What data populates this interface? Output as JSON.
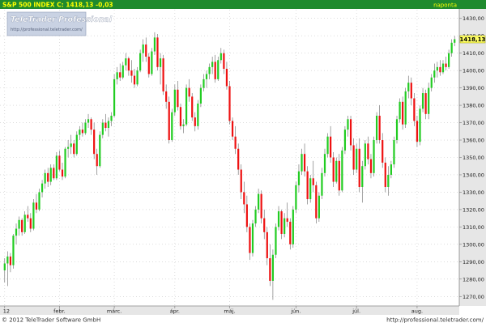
{
  "header": {
    "series_label": "S&P 500 INDEX C: 1418,13 -0,03",
    "period_label": "naponta"
  },
  "watermark": {
    "title": "TeleTrader Professional",
    "url": "http://professional.teletrader.com/"
  },
  "footer": {
    "copyright": "© 2012 TeleTrader Software GmbH",
    "url": "http://professional.teletrader.com/"
  },
  "last_price_label": "1418,13",
  "colors": {
    "header_bg": "#1f8a2e",
    "header_text": "#ffff00",
    "up": "#22cc22",
    "down": "#ee1111",
    "wick": "#666666",
    "grid": "#c8c8c8",
    "axis_panel": "#e6e6e6",
    "price_box": "#ffff66"
  },
  "chart_data": {
    "type": "candlestick",
    "title": "S&P 500 INDEX",
    "ylim": [
      1265,
      1435
    ],
    "y_ticks": [
      1270,
      1280,
      1290,
      1300,
      1310,
      1320,
      1330,
      1340,
      1350,
      1360,
      1370,
      1380,
      1390,
      1400,
      1410,
      1420,
      1430
    ],
    "y_tick_labels": [
      "1270,00",
      "1280,00",
      "1290,00",
      "1300,00",
      "1310,00",
      "1320,00",
      "1330,00",
      "1340,00",
      "1350,00",
      "1360,00",
      "1370,00",
      "1380,00",
      "1390,00",
      "1400,00",
      "1410,00",
      "1420,00",
      "1430,00"
    ],
    "x_ticks": [
      {
        "label": "12",
        "index": 0
      },
      {
        "label": "febr.",
        "index": 19
      },
      {
        "label": "márc.",
        "index": 38
      },
      {
        "label": "ápr.",
        "index": 59
      },
      {
        "label": "máj.",
        "index": 78
      },
      {
        "label": "jún.",
        "index": 101
      },
      {
        "label": "júl.",
        "index": 122
      },
      {
        "label": "aug.",
        "index": 143
      }
    ],
    "grid": true,
    "ohlc": [
      {
        "o": 1285,
        "h": 1292,
        "l": 1278,
        "c": 1289
      },
      {
        "o": 1289,
        "h": 1296,
        "l": 1276,
        "c": 1293
      },
      {
        "o": 1293,
        "h": 1295,
        "l": 1284,
        "c": 1288
      },
      {
        "o": 1288,
        "h": 1306,
        "l": 1286,
        "c": 1305
      },
      {
        "o": 1305,
        "h": 1312,
        "l": 1300,
        "c": 1309
      },
      {
        "o": 1309,
        "h": 1316,
        "l": 1305,
        "c": 1314
      },
      {
        "o": 1314,
        "h": 1315,
        "l": 1305,
        "c": 1307
      },
      {
        "o": 1307,
        "h": 1319,
        "l": 1306,
        "c": 1317
      },
      {
        "o": 1317,
        "h": 1322,
        "l": 1313,
        "c": 1315
      },
      {
        "o": 1315,
        "h": 1318,
        "l": 1307,
        "c": 1309
      },
      {
        "o": 1309,
        "h": 1326,
        "l": 1308,
        "c": 1324
      },
      {
        "o": 1324,
        "h": 1329,
        "l": 1318,
        "c": 1320
      },
      {
        "o": 1320,
        "h": 1332,
        "l": 1319,
        "c": 1330
      },
      {
        "o": 1330,
        "h": 1337,
        "l": 1327,
        "c": 1335
      },
      {
        "o": 1335,
        "h": 1343,
        "l": 1332,
        "c": 1341
      },
      {
        "o": 1341,
        "h": 1344,
        "l": 1333,
        "c": 1336
      },
      {
        "o": 1336,
        "h": 1346,
        "l": 1334,
        "c": 1344
      },
      {
        "o": 1344,
        "h": 1346,
        "l": 1337,
        "c": 1338
      },
      {
        "o": 1338,
        "h": 1353,
        "l": 1337,
        "c": 1351
      },
      {
        "o": 1351,
        "h": 1354,
        "l": 1342,
        "c": 1343
      },
      {
        "o": 1343,
        "h": 1347,
        "l": 1337,
        "c": 1339
      },
      {
        "o": 1339,
        "h": 1356,
        "l": 1338,
        "c": 1355
      },
      {
        "o": 1355,
        "h": 1360,
        "l": 1350,
        "c": 1356
      },
      {
        "o": 1356,
        "h": 1363,
        "l": 1352,
        "c": 1358
      },
      {
        "o": 1358,
        "h": 1360,
        "l": 1350,
        "c": 1352
      },
      {
        "o": 1352,
        "h": 1365,
        "l": 1351,
        "c": 1363
      },
      {
        "o": 1363,
        "h": 1368,
        "l": 1360,
        "c": 1366
      },
      {
        "o": 1366,
        "h": 1370,
        "l": 1362,
        "c": 1364
      },
      {
        "o": 1364,
        "h": 1372,
        "l": 1363,
        "c": 1370
      },
      {
        "o": 1370,
        "h": 1375,
        "l": 1367,
        "c": 1372
      },
      {
        "o": 1372,
        "h": 1373,
        "l": 1363,
        "c": 1366
      },
      {
        "o": 1366,
        "h": 1370,
        "l": 1349,
        "c": 1352
      },
      {
        "o": 1352,
        "h": 1355,
        "l": 1340,
        "c": 1345
      },
      {
        "o": 1345,
        "h": 1365,
        "l": 1344,
        "c": 1363
      },
      {
        "o": 1363,
        "h": 1372,
        "l": 1361,
        "c": 1370
      },
      {
        "o": 1370,
        "h": 1375,
        "l": 1365,
        "c": 1367
      },
      {
        "o": 1367,
        "h": 1373,
        "l": 1362,
        "c": 1371
      },
      {
        "o": 1371,
        "h": 1376,
        "l": 1368,
        "c": 1374
      },
      {
        "o": 1374,
        "h": 1398,
        "l": 1373,
        "c": 1395
      },
      {
        "o": 1395,
        "h": 1402,
        "l": 1392,
        "c": 1399
      },
      {
        "o": 1399,
        "h": 1404,
        "l": 1394,
        "c": 1396
      },
      {
        "o": 1396,
        "h": 1405,
        "l": 1395,
        "c": 1403
      },
      {
        "o": 1403,
        "h": 1410,
        "l": 1400,
        "c": 1407
      },
      {
        "o": 1407,
        "h": 1408,
        "l": 1397,
        "c": 1400
      },
      {
        "o": 1400,
        "h": 1406,
        "l": 1393,
        "c": 1397
      },
      {
        "o": 1397,
        "h": 1401,
        "l": 1390,
        "c": 1392
      },
      {
        "o": 1392,
        "h": 1402,
        "l": 1391,
        "c": 1400
      },
      {
        "o": 1400,
        "h": 1412,
        "l": 1399,
        "c": 1410
      },
      {
        "o": 1410,
        "h": 1418,
        "l": 1405,
        "c": 1415
      },
      {
        "o": 1415,
        "h": 1419,
        "l": 1405,
        "c": 1408
      },
      {
        "o": 1408,
        "h": 1410,
        "l": 1396,
        "c": 1398
      },
      {
        "o": 1398,
        "h": 1413,
        "l": 1397,
        "c": 1411
      },
      {
        "o": 1411,
        "h": 1422,
        "l": 1409,
        "c": 1419
      },
      {
        "o": 1419,
        "h": 1421,
        "l": 1400,
        "c": 1402
      },
      {
        "o": 1402,
        "h": 1410,
        "l": 1392,
        "c": 1407
      },
      {
        "o": 1407,
        "h": 1409,
        "l": 1386,
        "c": 1388
      },
      {
        "o": 1388,
        "h": 1392,
        "l": 1378,
        "c": 1382
      },
      {
        "o": 1382,
        "h": 1385,
        "l": 1358,
        "c": 1360
      },
      {
        "o": 1360,
        "h": 1378,
        "l": 1359,
        "c": 1376
      },
      {
        "o": 1376,
        "h": 1392,
        "l": 1374,
        "c": 1389
      },
      {
        "o": 1389,
        "h": 1394,
        "l": 1377,
        "c": 1379
      },
      {
        "o": 1379,
        "h": 1381,
        "l": 1366,
        "c": 1368
      },
      {
        "o": 1368,
        "h": 1372,
        "l": 1364,
        "c": 1369
      },
      {
        "o": 1369,
        "h": 1392,
        "l": 1368,
        "c": 1390
      },
      {
        "o": 1390,
        "h": 1395,
        "l": 1382,
        "c": 1385
      },
      {
        "o": 1385,
        "h": 1387,
        "l": 1371,
        "c": 1373
      },
      {
        "o": 1373,
        "h": 1376,
        "l": 1365,
        "c": 1368
      },
      {
        "o": 1368,
        "h": 1383,
        "l": 1366,
        "c": 1381
      },
      {
        "o": 1381,
        "h": 1392,
        "l": 1379,
        "c": 1390
      },
      {
        "o": 1390,
        "h": 1398,
        "l": 1388,
        "c": 1395
      },
      {
        "o": 1395,
        "h": 1400,
        "l": 1390,
        "c": 1398
      },
      {
        "o": 1398,
        "h": 1404,
        "l": 1395,
        "c": 1402
      },
      {
        "o": 1402,
        "h": 1408,
        "l": 1398,
        "c": 1405
      },
      {
        "o": 1405,
        "h": 1409,
        "l": 1393,
        "c": 1395
      },
      {
        "o": 1395,
        "h": 1408,
        "l": 1394,
        "c": 1406
      },
      {
        "o": 1406,
        "h": 1413,
        "l": 1404,
        "c": 1410
      },
      {
        "o": 1410,
        "h": 1412,
        "l": 1398,
        "c": 1401
      },
      {
        "o": 1401,
        "h": 1405,
        "l": 1389,
        "c": 1391
      },
      {
        "o": 1391,
        "h": 1394,
        "l": 1369,
        "c": 1371
      },
      {
        "o": 1371,
        "h": 1373,
        "l": 1360,
        "c": 1362
      },
      {
        "o": 1362,
        "h": 1368,
        "l": 1352,
        "c": 1355
      },
      {
        "o": 1355,
        "h": 1358,
        "l": 1340,
        "c": 1343
      },
      {
        "o": 1343,
        "h": 1346,
        "l": 1326,
        "c": 1330
      },
      {
        "o": 1330,
        "h": 1336,
        "l": 1318,
        "c": 1323
      },
      {
        "o": 1323,
        "h": 1328,
        "l": 1307,
        "c": 1310
      },
      {
        "o": 1310,
        "h": 1312,
        "l": 1291,
        "c": 1295
      },
      {
        "o": 1295,
        "h": 1314,
        "l": 1293,
        "c": 1312
      },
      {
        "o": 1312,
        "h": 1322,
        "l": 1310,
        "c": 1320
      },
      {
        "o": 1320,
        "h": 1332,
        "l": 1318,
        "c": 1329
      },
      {
        "o": 1329,
        "h": 1331,
        "l": 1312,
        "c": 1315
      },
      {
        "o": 1315,
        "h": 1320,
        "l": 1303,
        "c": 1307
      },
      {
        "o": 1307,
        "h": 1310,
        "l": 1288,
        "c": 1292
      },
      {
        "o": 1292,
        "h": 1300,
        "l": 1276,
        "c": 1279
      },
      {
        "o": 1279,
        "h": 1297,
        "l": 1268,
        "c": 1294
      },
      {
        "o": 1294,
        "h": 1312,
        "l": 1292,
        "c": 1310
      },
      {
        "o": 1310,
        "h": 1322,
        "l": 1308,
        "c": 1319
      },
      {
        "o": 1319,
        "h": 1320,
        "l": 1303,
        "c": 1306
      },
      {
        "o": 1306,
        "h": 1318,
        "l": 1304,
        "c": 1315
      },
      {
        "o": 1315,
        "h": 1324,
        "l": 1310,
        "c": 1313
      },
      {
        "o": 1313,
        "h": 1315,
        "l": 1297,
        "c": 1300
      },
      {
        "o": 1300,
        "h": 1322,
        "l": 1298,
        "c": 1320
      },
      {
        "o": 1320,
        "h": 1336,
        "l": 1318,
        "c": 1334
      },
      {
        "o": 1334,
        "h": 1346,
        "l": 1330,
        "c": 1342
      },
      {
        "o": 1342,
        "h": 1355,
        "l": 1340,
        "c": 1352
      },
      {
        "o": 1352,
        "h": 1358,
        "l": 1339,
        "c": 1342
      },
      {
        "o": 1342,
        "h": 1345,
        "l": 1323,
        "c": 1326
      },
      {
        "o": 1326,
        "h": 1340,
        "l": 1324,
        "c": 1338
      },
      {
        "o": 1338,
        "h": 1348,
        "l": 1330,
        "c": 1334
      },
      {
        "o": 1334,
        "h": 1336,
        "l": 1312,
        "c": 1315
      },
      {
        "o": 1315,
        "h": 1330,
        "l": 1313,
        "c": 1328
      },
      {
        "o": 1328,
        "h": 1344,
        "l": 1326,
        "c": 1341
      },
      {
        "o": 1341,
        "h": 1355,
        "l": 1339,
        "c": 1352
      },
      {
        "o": 1352,
        "h": 1364,
        "l": 1350,
        "c": 1362
      },
      {
        "o": 1362,
        "h": 1368,
        "l": 1347,
        "c": 1350
      },
      {
        "o": 1350,
        "h": 1353,
        "l": 1333,
        "c": 1336
      },
      {
        "o": 1336,
        "h": 1350,
        "l": 1335,
        "c": 1348
      },
      {
        "o": 1348,
        "h": 1352,
        "l": 1328,
        "c": 1331
      },
      {
        "o": 1331,
        "h": 1356,
        "l": 1330,
        "c": 1354
      },
      {
        "o": 1354,
        "h": 1368,
        "l": 1352,
        "c": 1366
      },
      {
        "o": 1366,
        "h": 1374,
        "l": 1362,
        "c": 1372
      },
      {
        "o": 1372,
        "h": 1374,
        "l": 1354,
        "c": 1357
      },
      {
        "o": 1357,
        "h": 1361,
        "l": 1340,
        "c": 1343
      },
      {
        "o": 1343,
        "h": 1358,
        "l": 1341,
        "c": 1355
      },
      {
        "o": 1355,
        "h": 1361,
        "l": 1330,
        "c": 1333
      },
      {
        "o": 1333,
        "h": 1348,
        "l": 1324,
        "c": 1345
      },
      {
        "o": 1345,
        "h": 1360,
        "l": 1343,
        "c": 1358
      },
      {
        "o": 1358,
        "h": 1362,
        "l": 1346,
        "c": 1349
      },
      {
        "o": 1349,
        "h": 1352,
        "l": 1338,
        "c": 1341
      },
      {
        "o": 1341,
        "h": 1362,
        "l": 1339,
        "c": 1360
      },
      {
        "o": 1360,
        "h": 1376,
        "l": 1358,
        "c": 1374
      },
      {
        "o": 1374,
        "h": 1380,
        "l": 1358,
        "c": 1360
      },
      {
        "o": 1360,
        "h": 1364,
        "l": 1344,
        "c": 1347
      },
      {
        "o": 1347,
        "h": 1350,
        "l": 1330,
        "c": 1333
      },
      {
        "o": 1333,
        "h": 1345,
        "l": 1328,
        "c": 1340
      },
      {
        "o": 1340,
        "h": 1348,
        "l": 1338,
        "c": 1346
      },
      {
        "o": 1346,
        "h": 1362,
        "l": 1344,
        "c": 1360
      },
      {
        "o": 1360,
        "h": 1374,
        "l": 1358,
        "c": 1372
      },
      {
        "o": 1372,
        "h": 1384,
        "l": 1370,
        "c": 1382
      },
      {
        "o": 1382,
        "h": 1385,
        "l": 1366,
        "c": 1369
      },
      {
        "o": 1369,
        "h": 1390,
        "l": 1367,
        "c": 1388
      },
      {
        "o": 1388,
        "h": 1397,
        "l": 1384,
        "c": 1393
      },
      {
        "o": 1393,
        "h": 1396,
        "l": 1380,
        "c": 1384
      },
      {
        "o": 1384,
        "h": 1387,
        "l": 1368,
        "c": 1371
      },
      {
        "o": 1371,
        "h": 1374,
        "l": 1356,
        "c": 1359
      },
      {
        "o": 1359,
        "h": 1380,
        "l": 1357,
        "c": 1378
      },
      {
        "o": 1378,
        "h": 1390,
        "l": 1376,
        "c": 1387
      },
      {
        "o": 1387,
        "h": 1389,
        "l": 1372,
        "c": 1375
      },
      {
        "o": 1375,
        "h": 1393,
        "l": 1372,
        "c": 1390
      },
      {
        "o": 1390,
        "h": 1398,
        "l": 1388,
        "c": 1396
      },
      {
        "o": 1396,
        "h": 1404,
        "l": 1393,
        "c": 1400
      },
      {
        "o": 1400,
        "h": 1405,
        "l": 1396,
        "c": 1402
      },
      {
        "o": 1402,
        "h": 1406,
        "l": 1397,
        "c": 1399
      },
      {
        "o": 1399,
        "h": 1406,
        "l": 1398,
        "c": 1404
      },
      {
        "o": 1404,
        "h": 1408,
        "l": 1400,
        "c": 1402
      },
      {
        "o": 1402,
        "h": 1412,
        "l": 1401,
        "c": 1410
      },
      {
        "o": 1410,
        "h": 1418,
        "l": 1408,
        "c": 1416
      },
      {
        "o": 1416,
        "h": 1420,
        "l": 1414,
        "c": 1418
      }
    ]
  }
}
